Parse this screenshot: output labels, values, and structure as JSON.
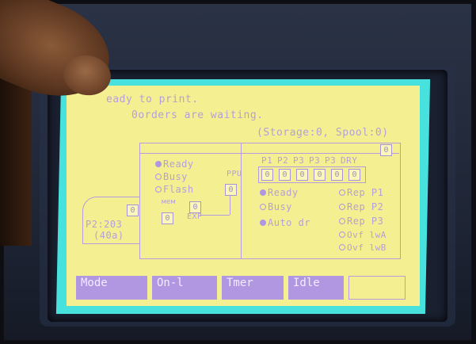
{
  "screen": {
    "message_line1": "eady to print.",
    "message_line2": "0orders are waiting.",
    "message_line3": "(Storage:0, Spool:0)",
    "top_right_value": "0",
    "left_panel": {
      "status_ready": "Ready",
      "status_busy": "Busy",
      "status_flash": "Flash",
      "ppu_label": "PPU",
      "ppu_value": "0",
      "mem_label": "мем",
      "mem_value": "0",
      "exp_label": "EXP",
      "exp_value": "0",
      "in_value": "0",
      "paper_label": "P2:203",
      "paper_size": "(40a)"
    },
    "right_panel": {
      "headers": [
        "P1",
        "P2",
        "P3",
        "P3",
        "P3",
        "DRY"
      ],
      "cells": [
        "0",
        "0",
        "0",
        "0",
        "0",
        "0"
      ],
      "left_status": [
        "Ready",
        "Busy",
        "Auto dr"
      ],
      "right_status": [
        "Rep P1",
        "Rep P2",
        "Rep P3",
        "Ovf lwA",
        "Ovf lwB"
      ]
    },
    "buttons": [
      "Mode",
      "On-l",
      "Tmer",
      "Idle",
      ""
    ]
  }
}
